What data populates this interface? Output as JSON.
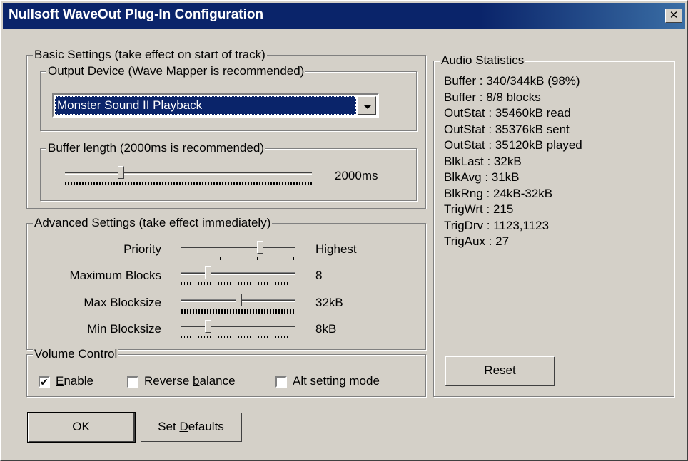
{
  "window": {
    "title": "Nullsoft WaveOut Plug-In Configuration",
    "close_glyph": "✕"
  },
  "basic": {
    "legend": "Basic Settings (take effect on start of track)",
    "output_device": {
      "legend": "Output Device (Wave Mapper is recommended)",
      "selected": "Monster Sound II Playback"
    },
    "buffer": {
      "legend": "Buffer length (2000ms is recommended)",
      "value_label": "2000ms",
      "slider_fraction": 0.22
    }
  },
  "advanced": {
    "legend": "Advanced Settings (take effect immediately)",
    "rows": [
      {
        "label": "Priority",
        "value": "Highest",
        "slider_fraction": 0.7
      },
      {
        "label": "Maximum Blocks",
        "value": "8",
        "slider_fraction": 0.22
      },
      {
        "label": "Max Blocksize",
        "value": "32kB",
        "slider_fraction": 0.5
      },
      {
        "label": "Min Blocksize",
        "value": "8kB",
        "slider_fraction": 0.22
      }
    ]
  },
  "volume": {
    "legend": "Volume Control",
    "enable": {
      "pre": "",
      "key": "E",
      "post": "nable",
      "checked": true
    },
    "reverse": {
      "pre": "Reverse ",
      "key": "b",
      "post": "alance",
      "checked": false
    },
    "alt": {
      "pre": "Alt setting mode",
      "key": "",
      "post": "",
      "checked": false
    }
  },
  "buttons": {
    "ok": "OK",
    "set_defaults": {
      "pre": "Set ",
      "key": "D",
      "post": "efaults"
    },
    "reset": {
      "pre": "",
      "key": "R",
      "post": "eset"
    }
  },
  "stats": {
    "legend": "Audio Statistics",
    "lines": [
      "Buffer   : 340/344kB (98%)",
      "Buffer   : 8/8 blocks",
      "OutStat : 35460kB read",
      "OutStat : 35376kB sent",
      "OutStat : 35120kB played",
      "BlkLast : 32kB",
      "BlkAvg  : 31kB",
      "BlkRng  : 24kB-32kB",
      "TrigWrt  : 215",
      "TrigDrv  : 1123,1123",
      "TrigAux : 27"
    ]
  }
}
